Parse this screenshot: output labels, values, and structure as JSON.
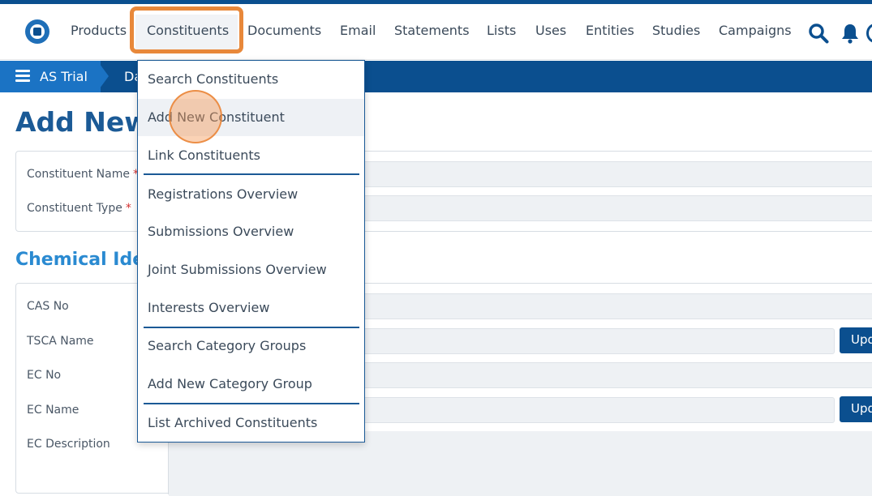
{
  "navbar": {
    "items": [
      {
        "label": "Products"
      },
      {
        "label": "Constituents"
      },
      {
        "label": "Documents"
      },
      {
        "label": "Email"
      },
      {
        "label": "Statements"
      },
      {
        "label": "Lists"
      },
      {
        "label": "Uses"
      },
      {
        "label": "Entities"
      },
      {
        "label": "Studies"
      },
      {
        "label": "Campaigns"
      }
    ],
    "active": "Constituents",
    "icons": [
      "logo-icon",
      "search-icon",
      "bell-icon",
      "avatar-icon"
    ]
  },
  "breadcrumb": {
    "first": "AS Trial",
    "second": "Da"
  },
  "page": {
    "title": "Add New"
  },
  "form": {
    "constituent_name_label": "Constituent Name",
    "constituent_type_label": "Constituent Type",
    "required_mark": "*"
  },
  "chemical_section": {
    "title": "Chemical Ident",
    "labels": {
      "cas_no": "CAS No",
      "tsca_name": "TSCA Name",
      "ec_no": "EC No",
      "ec_name": "EC Name",
      "ec_description": "EC Description"
    },
    "update_button_label": "Upd"
  },
  "dropdown": {
    "items": [
      {
        "label": "Search Constituents"
      },
      {
        "label": "Add New Constituent"
      },
      {
        "label": "Link Constituents"
      },
      {
        "label": "Registrations Overview"
      },
      {
        "label": "Submissions Overview"
      },
      {
        "label": "Joint Submissions Overview"
      },
      {
        "label": "Interests Overview"
      },
      {
        "label": "Search Category Groups"
      },
      {
        "label": "Add New Category Group"
      },
      {
        "label": "List Archived Constituents"
      }
    ],
    "hovered": "Add New Constituent"
  },
  "colors": {
    "brand": "#0b4f8f",
    "accent": "#2a8ad1",
    "highlight": "#e8883a"
  }
}
